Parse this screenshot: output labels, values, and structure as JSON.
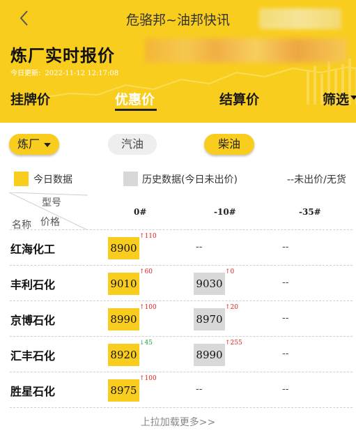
{
  "header": {
    "title": "危骆邦~油邦快讯",
    "page_title": "炼厂实时报价",
    "update_label": "今日更新:",
    "update_time": "2022-11-12 12:17:08"
  },
  "tabs": [
    {
      "label": "挂牌价",
      "active": false
    },
    {
      "label": "优惠价",
      "active": true
    },
    {
      "label": "结算价",
      "active": false
    },
    {
      "label": "筛选",
      "active": false
    }
  ],
  "filters": {
    "refinery": "炼厂",
    "gasoline": "汽油",
    "diesel": "柴油"
  },
  "legend": {
    "today": "今日数据",
    "history": "历史数据(今日未出价)",
    "none": "--未出价/无货"
  },
  "table": {
    "header": {
      "model": "型号",
      "price": "价格",
      "name": "名称"
    },
    "columns": [
      "0#",
      "-10#",
      "-35#"
    ],
    "rows": [
      {
        "name": "红海化工",
        "cells": [
          {
            "value": "8900",
            "kind": "today",
            "change": "110",
            "dir": "up"
          },
          {
            "value": "--",
            "kind": "none",
            "change": "",
            "dir": ""
          },
          {
            "value": "--",
            "kind": "none",
            "change": "",
            "dir": ""
          }
        ]
      },
      {
        "name": "丰利石化",
        "cells": [
          {
            "value": "9010",
            "kind": "today",
            "change": "60",
            "dir": "up"
          },
          {
            "value": "9030",
            "kind": "history",
            "change": "0",
            "dir": "none"
          },
          {
            "value": "--",
            "kind": "none",
            "change": "",
            "dir": ""
          }
        ]
      },
      {
        "name": "京博石化",
        "cells": [
          {
            "value": "8990",
            "kind": "today",
            "change": "100",
            "dir": "up"
          },
          {
            "value": "8970",
            "kind": "history",
            "change": "20",
            "dir": "up"
          },
          {
            "value": "--",
            "kind": "none",
            "change": "",
            "dir": ""
          }
        ]
      },
      {
        "name": "汇丰石化",
        "cells": [
          {
            "value": "8920",
            "kind": "today",
            "change": "45",
            "dir": "down"
          },
          {
            "value": "8990",
            "kind": "history",
            "change": "255",
            "dir": "up"
          },
          {
            "value": "--",
            "kind": "none",
            "change": "",
            "dir": ""
          }
        ]
      },
      {
        "name": "胜星石化",
        "cells": [
          {
            "value": "8975",
            "kind": "today",
            "change": "100",
            "dir": "up"
          },
          {
            "value": "--",
            "kind": "none",
            "change": "",
            "dir": ""
          },
          {
            "value": "--",
            "kind": "none",
            "change": "",
            "dir": ""
          }
        ]
      }
    ]
  },
  "footer": {
    "load_more": "上拉加载更多>>"
  },
  "colors": {
    "accent": "#f9cd1e",
    "history": "#d8d8d8",
    "up": "#e02020",
    "down": "#21a040"
  },
  "icons": {
    "back": "chevron-left-icon",
    "filter": "caret-down-icon"
  }
}
